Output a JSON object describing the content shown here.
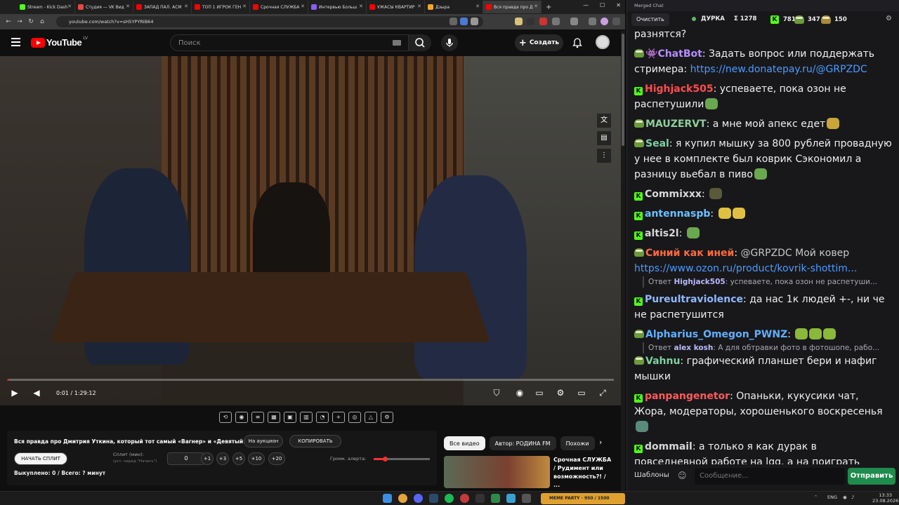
{
  "browser": {
    "tabs": [
      {
        "title": "Stream - Kick Dash",
        "color": "#53fc18"
      },
      {
        "title": "Студия — VK Вид",
        "color": "#e64646"
      },
      {
        "title": "ЗАПАД ПАЛ. АСМ",
        "color": "#ff0000"
      },
      {
        "title": "ТОП 1 ИГРОК ГЕН",
        "color": "#ff0000"
      },
      {
        "title": "Срочная СЛУЖБА",
        "color": "#ff0000"
      },
      {
        "title": "Интервью Больш",
        "color": "#8b5cf6"
      },
      {
        "title": "УЖАСЫ КВАРТИР",
        "color": "#ff0000"
      },
      {
        "title": "Дзыра",
        "color": "#f5a623"
      },
      {
        "title": "Вся правда про Д",
        "color": "#ff0000"
      }
    ],
    "url": "youtube.com/watch?v=sH5YPYRIB64"
  },
  "youtube": {
    "logo_text": "YouTube",
    "logo_region": "LV",
    "search_placeholder": "Поиск",
    "create_label": "Создать"
  },
  "player": {
    "time": "0:01 / 1:29:12",
    "progress": 0.0002
  },
  "panel": {
    "title": "Вся правда про Дмитрия Уткина, который тот самый «Вагнер» и «Девятый»!",
    "auction_btn": "На аукцион",
    "copy_btn": "КОПИРОВАТЬ",
    "start_split_btn": "НАЧАТЬ СПЛИТ",
    "split_label": "Сплит (мин):",
    "split_hint": "(уст. перед \"Начать\")",
    "split_value": "0",
    "increments": [
      "+1",
      "+3",
      "+5",
      "+10",
      "+20"
    ],
    "alert_volume_label": "Громк. алерта:",
    "alert_volume": 0.2,
    "bought": "Выкуплено: 0 / Всего: ? минут"
  },
  "recommendations": {
    "chips": [
      "Все видео",
      "Автор: РОДИНА FM",
      "Похожи"
    ],
    "video_title": "Срочная СЛУЖБА / Рудимент или возможность?! / ..."
  },
  "chat": {
    "window_title": "Merged Chat",
    "clear_label": "Очистить",
    "streamer": "ДУРКА",
    "total": "Σ 1278",
    "kick_count": "781",
    "other_count": "347",
    "extra_count": "150",
    "messages": [
      {
        "platform": "",
        "user": "",
        "color": "#efeff1",
        "text": "разнятся?"
      },
      {
        "platform": "pepe",
        "user": "ChatBot",
        "color": "#b48cff",
        "text": "Задать вопрос или поддержать стримера: ",
        "link": "https://new.donatepay.ru/@GRPZDC"
      },
      {
        "platform": "kick",
        "user": "Highjack505",
        "color": "#ff4d4d",
        "text": "успеваете, пока озон не распетушили"
      },
      {
        "platform": "pepe",
        "user": "MAUZERVT",
        "color": "#8fcf9a",
        "text": "а мне мой апекс едет"
      },
      {
        "platform": "pepe",
        "user": "Seal",
        "color": "#7fd0a0",
        "text": "я купил мышку за 800 рублей провадную у нее в комплекте был коврик    Сэкономил а разницу вьебал в пиво"
      },
      {
        "platform": "kick",
        "user": "Commixxx",
        "color": "#d7d7d7",
        "text": ""
      },
      {
        "platform": "kick",
        "user": "antennaspb",
        "color": "#6bc1ff",
        "text": ""
      },
      {
        "platform": "kick",
        "user": "altis2l",
        "color": "#d7d7d7",
        "text": ""
      },
      {
        "platform": "pepe",
        "user": "Синий как иней",
        "color": "#ff6a3d",
        "text": "@GRPZDC Мой ковер ",
        "link": "https://www.ozon.ru/product/kovrik-shottim..."
      },
      {
        "platform": "kick",
        "user": "Pureultraviolence",
        "color": "#8fb8ff",
        "text": "да нас 1к людей +-, ни че не распетушится"
      },
      {
        "platform": "pepe",
        "user": "Alpharius_Omegon_PWNZ",
        "color": "#5fb0ff",
        "text": ""
      },
      {
        "platform": "pepe",
        "user": "Vahnu",
        "color": "#7fd0a0",
        "text": "графический планшет бери и нафиг мышки"
      },
      {
        "platform": "kick",
        "user": "panpangenetor",
        "color": "#ff5a5a",
        "text": "Опаньки, кукусики чат, Жора, модераторы, хорошенького воскресенья"
      },
      {
        "platform": "kick",
        "user": "dommail",
        "color": "#d7d7d7",
        "text": "а только я как дурак в повседневной работе на lgg, а на поиграть достаю артисан?"
      }
    ],
    "reply1_prefix": "Ответ",
    "reply1_user": "Highjack505",
    "reply1_text": "успеваете, пока озон не распетуши...",
    "reply2_prefix": "Ответ",
    "reply2_user": "alex kosh",
    "reply2_text": "А для обтравки фото в фотошопе, рабо...",
    "templates_label": "Шаблоны",
    "input_placeholder": "Сообщение...",
    "send_label": "Отправить"
  },
  "taskbar": {
    "widget_text": "MEME PARTY",
    "widget_progress": "950 / 1500",
    "lang": "ENG",
    "time": "13:33",
    "date": "23.08.2026"
  }
}
